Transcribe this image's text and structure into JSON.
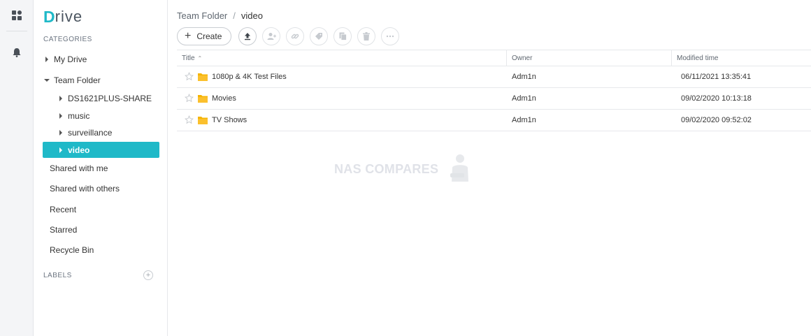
{
  "app": {
    "logo_first": "D",
    "logo_rest": "rive"
  },
  "rail": {
    "icons": [
      "apps-grid-icon",
      "bell-icon"
    ]
  },
  "sidebar": {
    "categories_title": "CATEGORIES",
    "my_drive": "My Drive",
    "team_folder": "Team Folder",
    "team_children": [
      "DS1621PLUS-SHARE",
      "music",
      "surveillance",
      "video"
    ],
    "shared_with_me": "Shared with me",
    "shared_with_others": "Shared with others",
    "recent": "Recent",
    "starred": "Starred",
    "recycle_bin": "Recycle Bin",
    "labels_title": "LABELS",
    "labels_add": "+"
  },
  "breadcrumb": {
    "parent": "Team Folder",
    "separator": "/",
    "current": "video"
  },
  "toolbar": {
    "create_label": "Create",
    "icons": [
      "upload-icon",
      "share-user-icon",
      "link-icon",
      "label-tag-icon",
      "copy-icon",
      "delete-icon",
      "more-icon"
    ]
  },
  "table": {
    "columns": {
      "title": "Title",
      "owner": "Owner",
      "modified": "Modified time"
    },
    "sort_indicator": "⌃",
    "rows": [
      {
        "name": "1080p & 4K Test Files",
        "owner": "Adm1n",
        "modified": "06/11/2021 13:35:41"
      },
      {
        "name": "Movies",
        "owner": "Adm1n",
        "modified": "09/02/2020 10:13:18"
      },
      {
        "name": "TV Shows",
        "owner": "Adm1n",
        "modified": "09/02/2020 09:52:02"
      }
    ]
  },
  "watermark": {
    "text": "NAS COMPARES"
  },
  "colors": {
    "accent": "#1fb9c8",
    "folder": "#f5b400"
  }
}
